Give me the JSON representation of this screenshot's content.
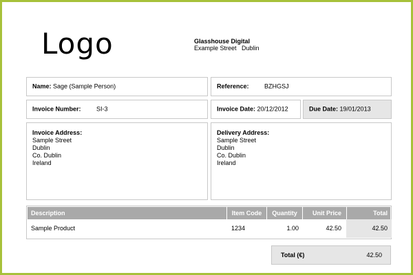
{
  "header": {
    "logo_text": "Logo",
    "company_name": "Glasshouse Digital",
    "company_address": "Example Street   Dublin"
  },
  "invoice": {
    "name_label": "Name:",
    "name_value": "Sage (Sample Person)",
    "reference_label": "Reference:",
    "reference_value": "BZHGSJ",
    "number_label": "Invoice Number:",
    "number_value": "SI-3",
    "date_label": "Invoice Date:",
    "date_value": "20/12/2012",
    "due_label": "Due Date:",
    "due_value": "19/01/2013"
  },
  "invoice_address": {
    "label": "Invoice Address:",
    "lines": [
      "Sample Street",
      "Dublin",
      "Co. Dublin",
      "Ireland"
    ]
  },
  "delivery_address": {
    "label": "Delivery Address:",
    "lines": [
      "Sample Street",
      "Dublin",
      "Co. Dublin",
      "Ireland"
    ]
  },
  "items": {
    "columns": [
      "Description",
      "Item Code",
      "Quantity",
      "Unit Price",
      "Total"
    ],
    "rows": [
      {
        "description": "Sample Product",
        "item_code": "1234",
        "quantity": "1.00",
        "unit_price": "42.50",
        "total": "42.50"
      }
    ]
  },
  "totals": {
    "label": "Total (€)",
    "value": "42.50"
  },
  "colors": {
    "border_accent": "#a7c13a",
    "header_bg": "#a9a9a9",
    "shade_bg": "#e6e6e6"
  }
}
